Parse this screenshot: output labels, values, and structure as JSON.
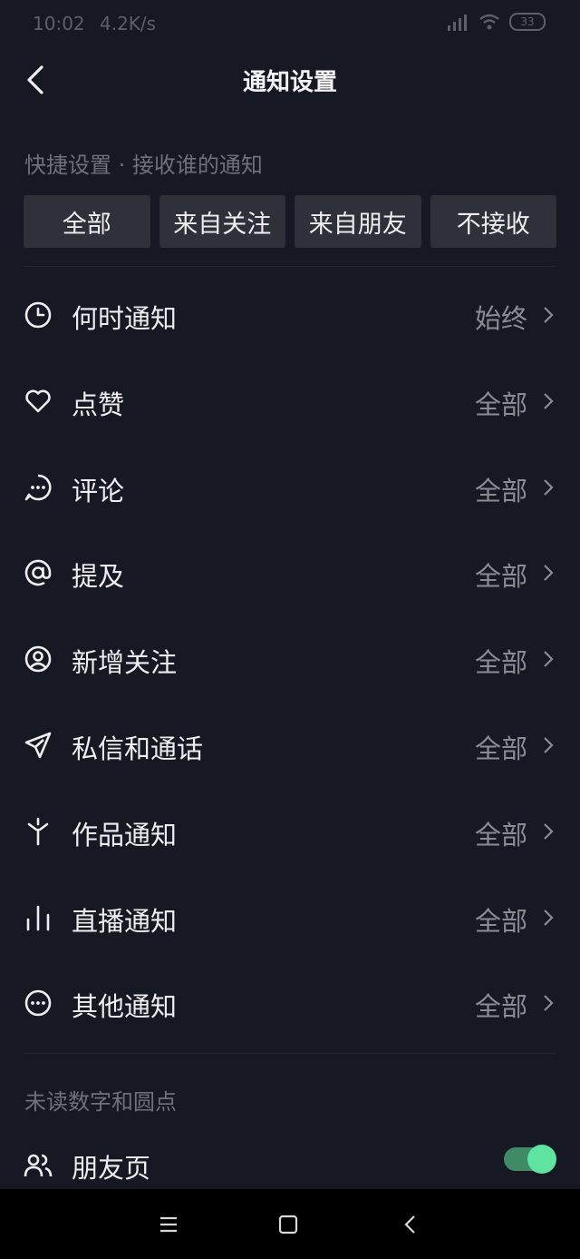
{
  "status_bar": {
    "time": "10:02",
    "speed": "4.2K/s",
    "battery": "33",
    "icons": [
      "signal-icon",
      "wifi-icon",
      "battery-icon"
    ]
  },
  "header": {
    "title": "通知设置",
    "back_icon": "back-arrow-icon"
  },
  "quick_settings": {
    "label": "快捷设置 · 接收谁的通知",
    "options": [
      "全部",
      "来自关注",
      "来自朋友",
      "不接收"
    ]
  },
  "notification_items": [
    {
      "icon": "clock-icon",
      "label": "何时通知",
      "value": "始终"
    },
    {
      "icon": "heart-icon",
      "label": "点赞",
      "value": "全部"
    },
    {
      "icon": "comment-icon",
      "label": "评论",
      "value": "全部"
    },
    {
      "icon": "at-icon",
      "label": "提及",
      "value": "全部"
    },
    {
      "icon": "user-icon",
      "label": "新增关注",
      "value": "全部"
    },
    {
      "icon": "send-icon",
      "label": "私信和通话",
      "value": "全部"
    },
    {
      "icon": "sparkle-icon",
      "label": "作品通知",
      "value": "全部"
    },
    {
      "icon": "live-bars-icon",
      "label": "直播通知",
      "value": "全部"
    },
    {
      "icon": "more-circle-icon",
      "label": "其他通知",
      "value": "全部"
    }
  ],
  "unread_section": {
    "label": "未读数字和圆点",
    "items": [
      {
        "icon": "friends-icon",
        "label": "朋友页",
        "enabled": true
      }
    ]
  },
  "colors": {
    "background": "#161823",
    "button_bg": "#2f313a",
    "toggle_on": "#5ee3a0"
  },
  "system_nav": {
    "icons": [
      "menu-icon",
      "home-icon",
      "back-icon"
    ]
  }
}
